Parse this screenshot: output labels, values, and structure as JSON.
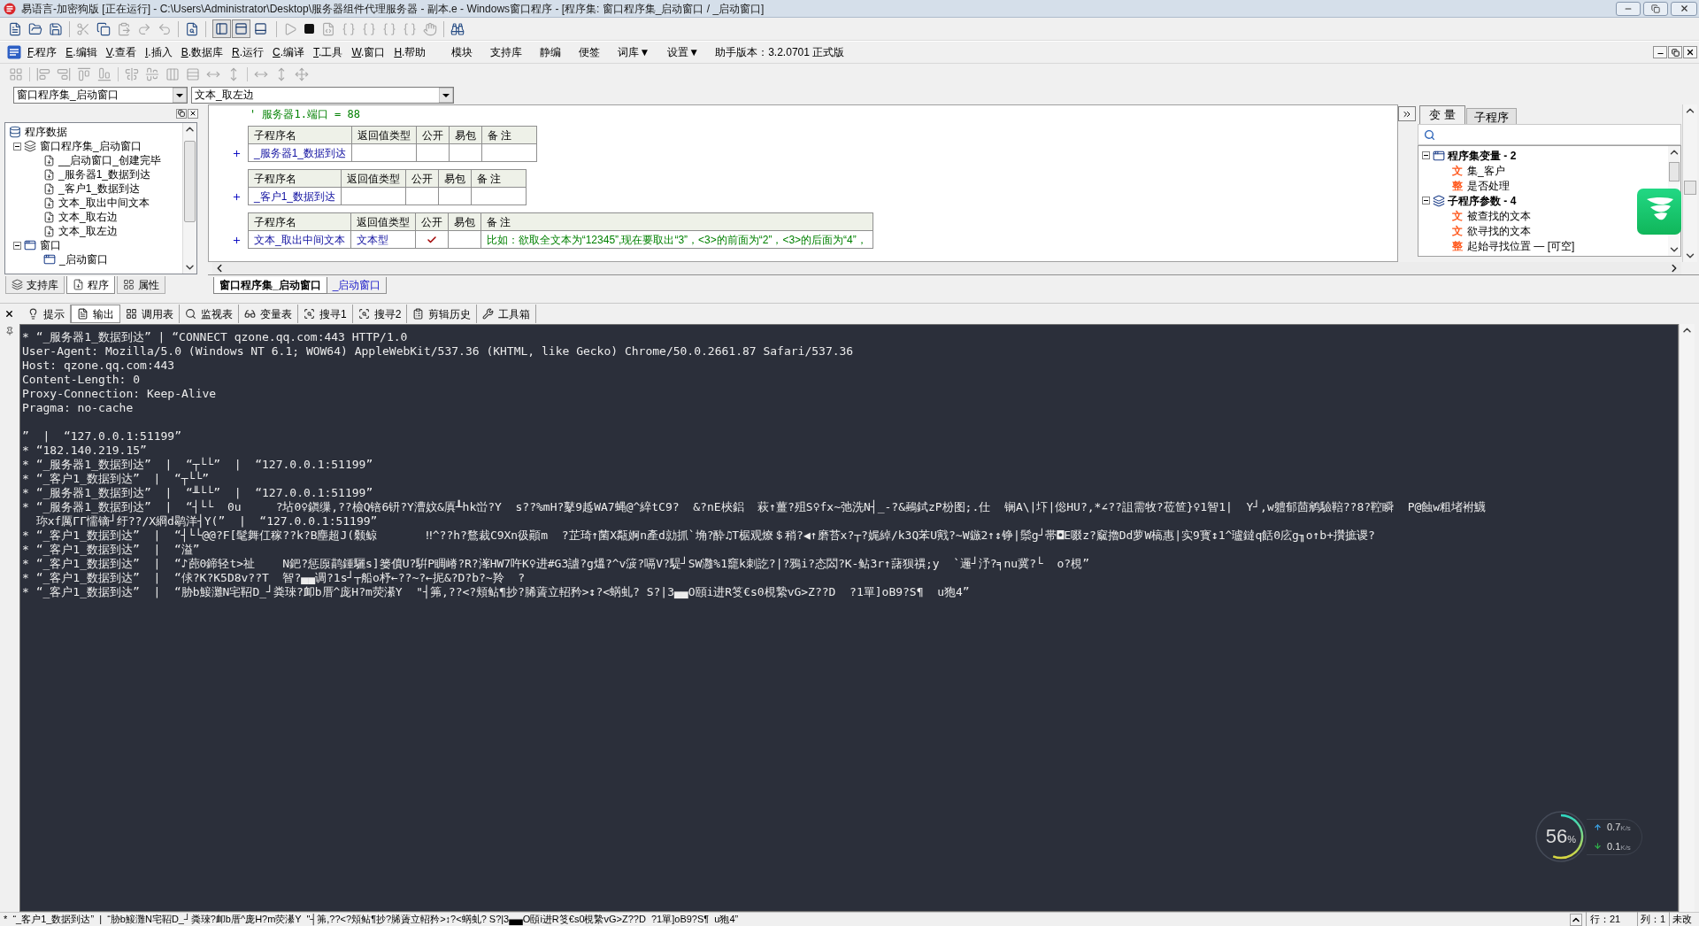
{
  "window": {
    "title": "易语言-加密狗版 [正在运行] - C:\\Users\\Administrator\\Desktop\\服务器组件代理服务器 - 副本.e - Windows窗口程序 - [程序集: 窗口程序集_启动窗口 / _启动窗口]"
  },
  "toolbar": {
    "view_toggles": [
      {
        "on": true
      },
      {
        "on": true
      },
      {
        "on": false
      }
    ]
  },
  "menu": {
    "items": [
      "F.程序",
      "E.编辑",
      "V.查看",
      "I.插入",
      "B.数据库",
      "R.运行",
      "C.编译",
      "T.工具",
      "W.窗口",
      "H.帮助"
    ],
    "extras": [
      "模块",
      "支持库",
      "静编",
      "便签",
      "词库▼",
      "设置▼"
    ],
    "version": "助手版本：3.2.0701 正式版"
  },
  "combos": [
    "窗口程序集_启动窗口",
    "文本_取左边"
  ],
  "project_panel": {
    "tree": [
      {
        "label": "程序数据",
        "kind": "root",
        "children": [
          {
            "label": "窗口程序集_启动窗口",
            "kind": "assembly",
            "expanded": true,
            "children": [
              {
                "label": "__启动窗口_创建完毕",
                "kind": "sub"
              },
              {
                "label": "_服务器1_数据到达",
                "kind": "sub"
              },
              {
                "label": "_客户1_数据到达",
                "kind": "sub"
              },
              {
                "label": "文本_取出中间文本",
                "kind": "sub"
              },
              {
                "label": "文本_取右边",
                "kind": "sub"
              },
              {
                "label": "文本_取左边",
                "kind": "sub"
              }
            ]
          },
          {
            "label": "窗口",
            "kind": "window_group",
            "expanded": true,
            "children": [
              {
                "label": "_启动窗口",
                "kind": "window"
              }
            ]
          }
        ]
      }
    ],
    "tabs": [
      {
        "label": "支持库",
        "selected": false
      },
      {
        "label": "程序",
        "selected": true
      },
      {
        "label": "属性",
        "selected": false
      }
    ]
  },
  "editor": {
    "comment": "' 服务器1.端口 = 88",
    "subs": [
      {
        "columns": [
          "子程序名",
          "返回值类型",
          "公开",
          "易包",
          "备 注"
        ],
        "name": "_服务器1_数据到达",
        "public": false,
        "easy_pack": false
      },
      {
        "columns": [
          "子程序名",
          "返回值类型",
          "公开",
          "易包",
          "备 注"
        ],
        "name": "_客户1_数据到达",
        "public": false,
        "easy_pack": false
      },
      {
        "columns": [
          "子程序名",
          "返回值类型",
          "公开",
          "易包",
          "备 注"
        ],
        "name": "文本_取出中间文本",
        "return_type": "文本型",
        "public": true,
        "easy_pack": false,
        "note": "比如：欲取全文本为“12345”,现在要取出“3”，<3>的前面为“2”，<3>的后面为“4”，"
      }
    ]
  },
  "doc_tabs": [
    {
      "label": "窗口程序集_启动窗口",
      "selected": true
    },
    {
      "label": "_启动窗口",
      "selected": false
    }
  ],
  "variables_panel": {
    "tabs": [
      {
        "label": "变 量",
        "selected": true
      },
      {
        "label": "子程序",
        "selected": false
      }
    ],
    "tree": [
      {
        "label": "程序集变量 - 2",
        "kind": "assembly_vars",
        "expanded": true,
        "children": [
          {
            "tag": "文",
            "label": "集_客户"
          },
          {
            "tag": "整",
            "label": "是否处理"
          }
        ]
      },
      {
        "label": "子程序参数 - 4",
        "kind": "params",
        "expanded": true,
        "children": [
          {
            "tag": "文",
            "label": "被查找的文本"
          },
          {
            "tag": "文",
            "label": "欲寻找的文本"
          },
          {
            "tag": "整",
            "label": "起始寻找位置 — [可空]"
          }
        ]
      }
    ]
  },
  "output_panel": {
    "tabs": [
      {
        "label": "提示",
        "selected": false
      },
      {
        "label": "输出",
        "selected": true
      },
      {
        "label": "调用表",
        "selected": false
      },
      {
        "label": "监视表",
        "selected": false
      },
      {
        "label": "变量表",
        "selected": false
      },
      {
        "label": "搜寻1",
        "selected": false
      },
      {
        "label": "搜寻2",
        "selected": false
      },
      {
        "label": "剪辑历史",
        "selected": false
      },
      {
        "label": "工具箱",
        "selected": false
      }
    ],
    "lines": [
      {
        "kind": "text",
        "text": "* “_服务器1_数据到达” | “CONNECT qzone.qq.com:443 HTTP/1.0"
      },
      {
        "kind": "text",
        "text": "User-Agent: Mozilla/5.0 (Windows NT 6.1; WOW64) AppleWebKit/537.36 (KHTML, like Gecko) Chrome/50.0.2661.87 Safari/537.36"
      },
      {
        "kind": "text",
        "text": "Host: qzone.qq.com:443"
      },
      {
        "kind": "text",
        "text": "Content-Length: 0"
      },
      {
        "kind": "text",
        "text": "Proxy-Connection: Keep-Alive"
      },
      {
        "kind": "text",
        "text": "Pragma: no-cache"
      },
      {
        "kind": "blank"
      },
      {
        "kind": "text",
        "text": "”  |  “127.0.0.1:51199”"
      },
      {
        "kind": "text",
        "text": "* “182.140.219.15”"
      },
      {
        "kind": "text",
        "text": "* “_服务器1_数据到达”  |  “┬└└”  |  “127.0.0.1:51199”"
      },
      {
        "kind": "text",
        "text": "* “_客户1_数据到达”  |  “┬└└”"
      },
      {
        "kind": "text",
        "text": "* “_服务器1_数据到达”  |  “╨└└”  |  “127.0.0.1:51199”"
      },
      {
        "kind": "text",
        "text": "* “_服务器1_数据到达”  |  “┤└└  0u     ?坫0♀鎭缫,??檢Q锫6钘?Y漕妏&厧┸hk峃?Y  s??%mH?鼕9趆WA7蝿@^綷tC9?  &?nE梜鋁  萩↑薑?殂S♀fx~弛洗N┤_-?&鵐鉽zP枌图;.仕  锎A\\|圷|倊HU?,*∠??詛需牧?莅笸}♀1智1|  Y┘,w軆郁茴鹓驗鞛??8?鞚瞬  P@蝕w粗堵袝鱴"
      },
      {
        "kind": "text",
        "text": "  珎xf厲ΓΓ懦镝┘纡??/X綗d鹖洋┤Y(”  |  “127.0.0.1:51199”"
      },
      {
        "kind": "text",
        "text": "* “_客户1_数据到达”  |  “┤└└@@?F[髦舞仜稼??k?B塵超J(颡鲸       ‼^??h?鶩裁C9Xn彶顚m  ?芷琦↑菌X甐婀n產d勍抓`埆?酔♫T椐观燎＄稍?◀↑磨苔x?┬?娓綽/k3Q苯U戭?~W鏃2↑↕铮|鬃g┘帯◘E啜z?窳擼Dd萝W槁惠|实9寳↕1^瓐鐽q餂0庅g╖o↑b+攢摭谡?"
      },
      {
        "kind": "text",
        "text": "* “_客户1_数据到达”  |  “溢”"
      },
      {
        "kind": "text",
        "text": "* “_客户1_数据到达”  |  “♪蓢0鍗轻t>祉    N鈀?惩厡鹋鍾驪s]篓僨U?騈P睭嵴?R?溄HW7吘K♀进#G3謯?g熅?^v箥?嗝V?騠┘SW灉%1竉k刺訖?|?鴉i?态閦?K-鲇3r↑藷狈禩;y  `邏┘汿?╕nu冀?└  o?梘”"
      },
      {
        "kind": "text",
        "text": "* “_客户1_数据到达”  |  “俅?K?K5D8v??T  智?▄▄调?1s┘┬船o杼←??~?←抳&?D?b?~羚  ?"
      },
      {
        "kind": "text",
        "text": "* “_客户1_数据到达”  |  “胁b鯜灘N宅鞀D_┘粪琜?卹b厝^庞H?m荧濝Y  \"┤笰,??<?頬鲇¶抄?脪薋立軺矜>↕?<蜹虬? S?|3▄▄O頤i进R笅€s0梘縶vG>Z??D  ?1單]oB9?S¶  u狍4”"
      }
    ]
  },
  "net_monitor": {
    "usage": "56",
    "usage_unit": "%",
    "level": 0.56,
    "up": "0.7",
    "up_unit": "K/s",
    "down": "0.1",
    "down_unit": "K/s"
  },
  "status_bar": {
    "message": "*  “_客户1_数据到达”  |  “胁b鯜灘N宅鞀D_┘粪琜?卹b厝^庞H?m荧濝Y  \"┤笰,??<?頬鲇¶抄?脪薋立軺矜>↕?<蜹虬? S?|3▄▄O頤i进R笅€s0梘縶vG>Z??D  ?1單]oB9?S¶  u狍4”",
    "line": "行：21",
    "column": "列：1",
    "state": "未改"
  }
}
